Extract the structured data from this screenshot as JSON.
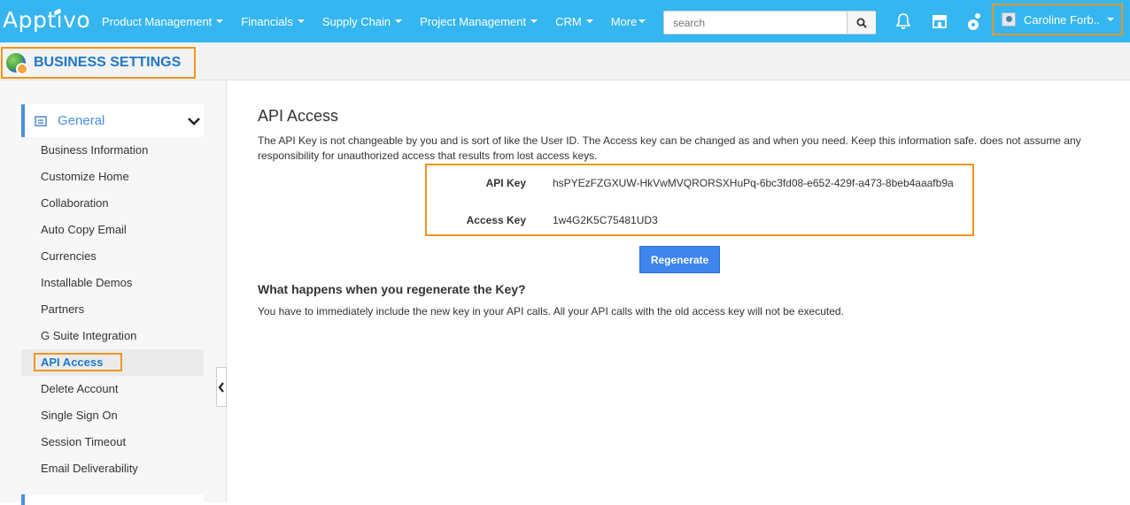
{
  "topbar": {
    "logo": "Apptivo",
    "nav": [
      "Product Management",
      "Financials",
      "Supply Chain",
      "Project Management",
      "CRM",
      "More"
    ],
    "search_placeholder": "search",
    "user_name": "Caroline Forb.."
  },
  "header": {
    "title": "BUSINESS SETTINGS"
  },
  "sidebar": {
    "group": "General",
    "items": [
      "Business Information",
      "Customize Home",
      "Collaboration",
      "Auto Copy Email",
      "Currencies",
      "Installable Demos",
      "Partners",
      "G Suite Integration",
      "API Access",
      "Delete Account",
      "Single Sign On",
      "Session Timeout",
      "Email Deliverability"
    ],
    "active": "API Access"
  },
  "main": {
    "heading": "API Access",
    "description": "The API Key is not changeable by you and is sort of like the User ID. The Access key can be changed as and when you need. Keep this information safe. does not assume any responsibility for unauthorized access that results from lost access keys.",
    "api_key_label": "API Key",
    "api_key_value": "hsPYEzFZGXUW-HkVwMVQRORSXHuPq-6bc3fd08-e652-429f-a473-8beb4aaafb9a",
    "access_key_label": "Access Key",
    "access_key_value": "1w4G2K5C75481UD3",
    "regenerate_label": "Regenerate",
    "sub_heading": "What happens when you regenerate the Key?",
    "note": "You have to immediately include the new key in your API calls. All your API calls with the old access key will not be executed."
  },
  "icons": {
    "search": "search-icon",
    "notifications": "bell-icon",
    "store": "store-icon",
    "users": "user-settings-icon",
    "collapse": "chevron-left-icon"
  },
  "colors": {
    "topbar": "#35b6f0",
    "accent": "#1f77c9",
    "highlight": "#f0961f",
    "button": "#3e85ee"
  }
}
